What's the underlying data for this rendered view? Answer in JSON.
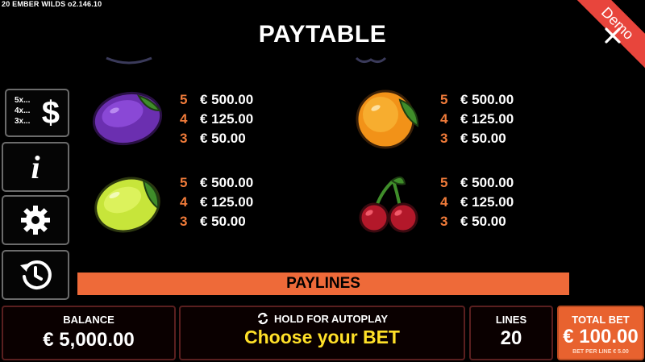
{
  "game": {
    "name_version": "20 EMBER WILDS  o2.146.10",
    "title": "PAYTABLE",
    "demo_label": "Demo"
  },
  "sidebar": {
    "paytable_multipliers": [
      "5x...",
      "4x...",
      "3x..."
    ],
    "paytable_symbol": "$",
    "info_symbol": "i"
  },
  "symbols": [
    {
      "name": "plum",
      "payouts": [
        {
          "count": "5",
          "amount": "€ 500.00"
        },
        {
          "count": "4",
          "amount": "€ 125.00"
        },
        {
          "count": "3",
          "amount": "€ 50.00"
        }
      ]
    },
    {
      "name": "orange",
      "payouts": [
        {
          "count": "5",
          "amount": "€ 500.00"
        },
        {
          "count": "4",
          "amount": "€ 125.00"
        },
        {
          "count": "3",
          "amount": "€ 50.00"
        }
      ]
    },
    {
      "name": "lemon",
      "payouts": [
        {
          "count": "5",
          "amount": "€ 500.00"
        },
        {
          "count": "4",
          "amount": "€ 125.00"
        },
        {
          "count": "3",
          "amount": "€ 50.00"
        }
      ]
    },
    {
      "name": "cherry",
      "payouts": [
        {
          "count": "5",
          "amount": "€ 500.00"
        },
        {
          "count": "4",
          "amount": "€ 125.00"
        },
        {
          "count": "3",
          "amount": "€ 50.00"
        }
      ]
    }
  ],
  "section": {
    "paylines": "PAYLINES"
  },
  "bottom": {
    "balance_label": "BALANCE",
    "balance_value": "€ 5,000.00",
    "hold_label": "HOLD FOR AUTOPLAY",
    "choose_label": "Choose your BET",
    "lines_label": "LINES",
    "lines_value": "20",
    "total_bet_label": "TOTAL BET",
    "total_bet_value": "€ 100.00",
    "bet_per_line": "BET PER LINE € 5.00"
  },
  "colors": {
    "accent_orange": "#ee6a39",
    "count_orange": "#f07b3a",
    "choose_yellow": "#ffe028",
    "demo_red": "#e8453c"
  }
}
